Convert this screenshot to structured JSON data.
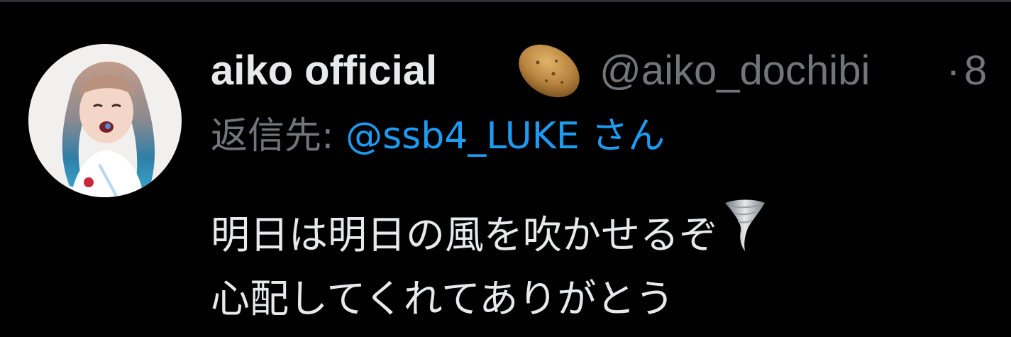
{
  "tweet": {
    "author": {
      "display_name": "aiko official",
      "name_emoji": "potato-icon",
      "handle": "@aiko_dochibi",
      "separator": "·",
      "timestamp_partial": "8"
    },
    "reply_to": {
      "label": "返信先: ",
      "target": "@ssb4_LUKE さん"
    },
    "body": {
      "line1": "明日は明日の風を吹かせるぞ",
      "line1_emoji": "tornado-icon",
      "line2": "心配してくれてありがとう"
    }
  },
  "colors": {
    "background": "#000000",
    "primary_text": "#e7e9ea",
    "secondary_text": "#71767b",
    "accent_link": "#1d9bf0"
  }
}
